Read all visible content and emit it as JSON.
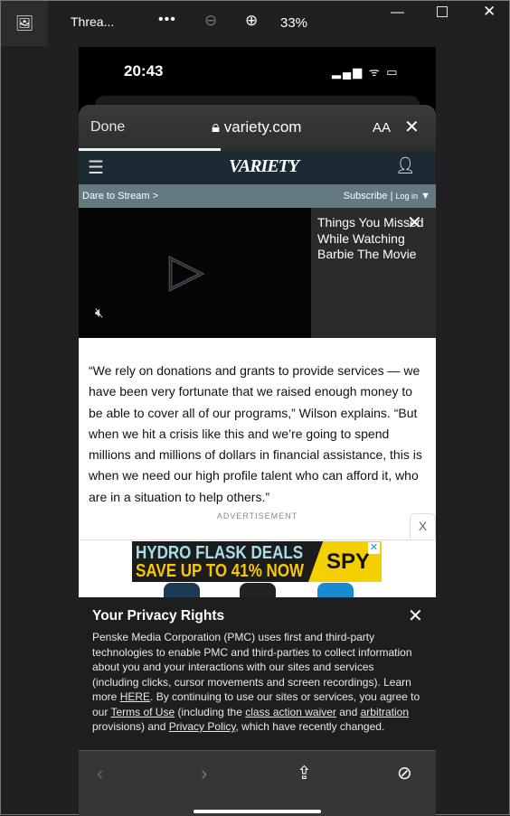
{
  "window": {
    "title": "Threa...",
    "zoom": "33%",
    "more": "•••"
  },
  "status": {
    "time": "20:43",
    "icons": "▂▄▆ ᯤ ▭"
  },
  "browser": {
    "done": "Done",
    "url": "variety.com",
    "text_size": "AA",
    "page_load_progress": 0.4
  },
  "site": {
    "logo": "VARIETY",
    "promo": "Dare to Stream >",
    "subscribe": "Subscribe",
    "login": "Log in"
  },
  "video": {
    "sidebar_title": "Things You Missed While Watching Barbie The Movie"
  },
  "article": {
    "text": "“We rely on donations and grants to provide services — we have been very fortunate that we raised enough money to be able to cover all of our programs,” Wilson explains. “But when we hit a crisis like this and we’re going to spend millions and millions of dollars in financial assistance, this is when we need our high profile talent who can afford it, who are in a situation to help others.”"
  },
  "ad": {
    "label": "ADVERTISEMENT",
    "close": "X",
    "line1": "HYDRO FLASK DEALS",
    "line2": "SAVE UP TO 41% NOW",
    "brand": "SPY"
  },
  "privacy": {
    "title": "Your Privacy Rights",
    "t1": "Penske Media Corporation (PMC) uses first and third-party technologies to enable PMC and third-parties to collect information about you and your interactions with our sites and services (including clicks, cursor movements and screen recordings). Learn more ",
    "here": "HERE",
    "t2": ". By continuing to use our sites or services, you agree to our ",
    "terms": "Terms of Use",
    "t3": " (including the ",
    "waiver": "class action waiver",
    "t4": " and ",
    "arbitration": "arbitration",
    "t5": " provisions) and ",
    "policy": "Privacy Policy",
    "t6": ", which have recently changed."
  }
}
